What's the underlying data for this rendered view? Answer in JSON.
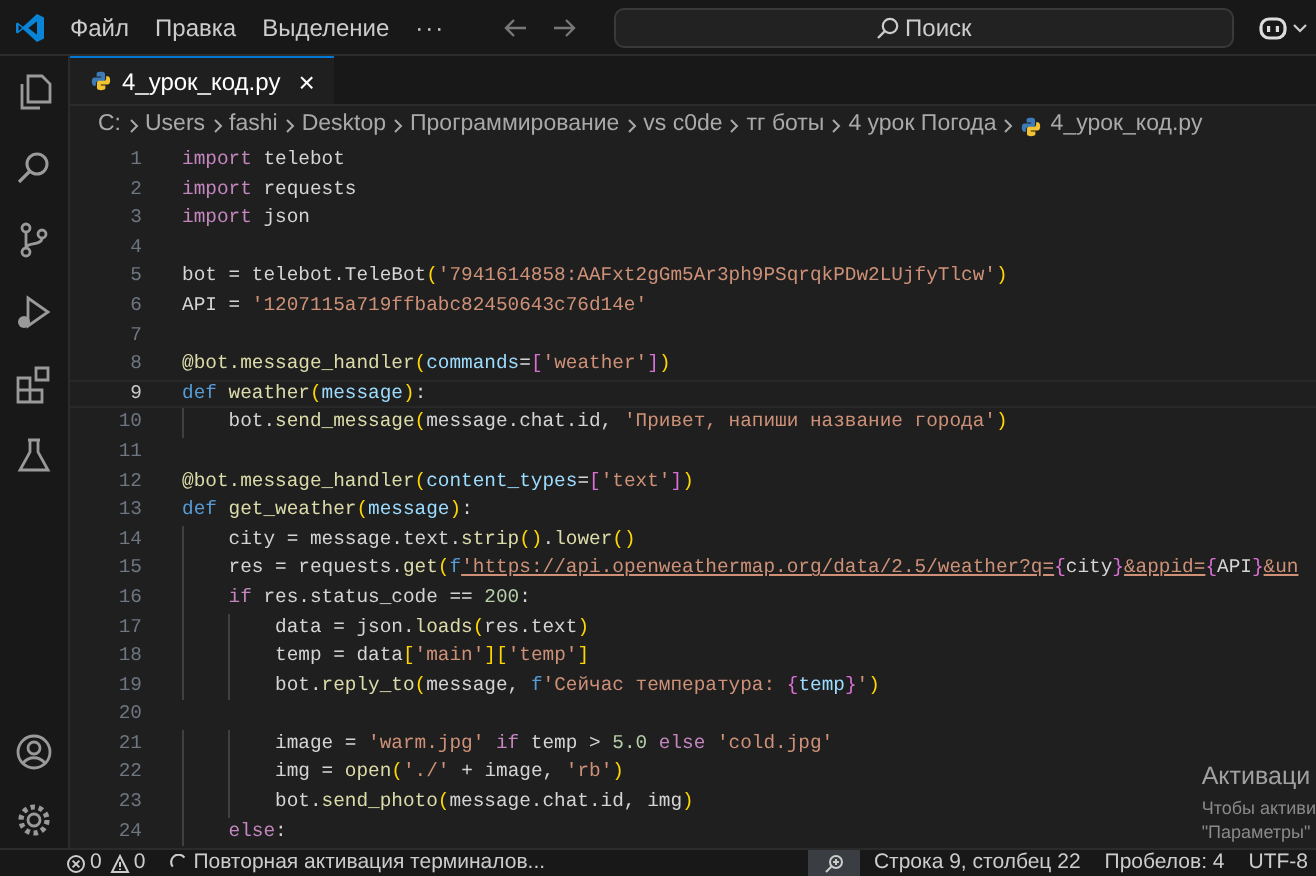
{
  "title_bar": {
    "menu": [
      "Файл",
      "Правка",
      "Выделение",
      "···"
    ],
    "search": {
      "placeholder": "Поиск"
    }
  },
  "tab": {
    "label": "4_урок_код.py",
    "selected": true,
    "close": "×"
  },
  "breadcrumbs": [
    "C:",
    "Users",
    "fashi",
    "Desktop",
    "Программирование",
    "vs c0de",
    "тг боты",
    "4 урок Погода",
    "4_урок_код.py"
  ],
  "editor": {
    "lines": [
      {
        "number": "1",
        "current": false,
        "tokens": [
          {
            "kind": "keyword",
            "text": "import"
          },
          {
            "kind": "plain",
            "text": " telebot"
          }
        ]
      },
      {
        "number": "2",
        "current": false,
        "tokens": [
          {
            "kind": "keyword",
            "text": "import"
          },
          {
            "kind": "plain",
            "text": " requests"
          }
        ]
      },
      {
        "number": "3",
        "current": false,
        "tokens": [
          {
            "kind": "keyword",
            "text": "import"
          },
          {
            "kind": "plain",
            "text": " json"
          }
        ]
      },
      {
        "number": "4",
        "current": false
      },
      {
        "number": "5",
        "current": false,
        "tokens": [
          {
            "kind": "plain",
            "text": "bot = telebot.TeleBot"
          },
          {
            "kind": "bracket1",
            "text": "("
          },
          {
            "kind": "string",
            "text": "'7941614858:AAFxt2gGm5Ar3ph9PSqrqkPDw2LUjfyTlcw'"
          },
          {
            "kind": "bracket1",
            "text": ")"
          }
        ]
      },
      {
        "number": "6",
        "current": false,
        "tokens": [
          {
            "kind": "plain",
            "text": "API = "
          },
          {
            "kind": "string",
            "text": "'1207115a719ffbabc82450643c76d14e'"
          }
        ]
      },
      {
        "number": "7",
        "current": false
      },
      {
        "number": "8",
        "current": false,
        "tokens": [
          {
            "kind": "function",
            "text": "@bot.message_handler"
          },
          {
            "kind": "bracket1",
            "text": "("
          },
          {
            "kind": "variable",
            "text": "commands"
          },
          {
            "kind": "plain",
            "text": "="
          },
          {
            "kind": "bracket2",
            "text": "["
          },
          {
            "kind": "string",
            "text": "'weather'"
          },
          {
            "kind": "bracket2",
            "text": "]"
          },
          {
            "kind": "bracket1",
            "text": ")"
          }
        ]
      },
      {
        "number": "9",
        "current": true,
        "tokens": [
          {
            "kind": "storage",
            "text": "def"
          },
          {
            "kind": "function",
            "text": " weather"
          },
          {
            "kind": "bracket1",
            "text": "("
          },
          {
            "kind": "variable",
            "text": "message"
          },
          {
            "kind": "bracket1",
            "text": ")"
          },
          {
            "kind": "plain",
            "text": ":"
          }
        ]
      },
      {
        "number": "10",
        "current": false,
        "tokens": [
          {
            "kind": "plain",
            "text": "    bot."
          },
          {
            "kind": "function",
            "text": "send_message"
          },
          {
            "kind": "bracket1",
            "text": "("
          },
          {
            "kind": "plain",
            "text": "message.chat.id, "
          },
          {
            "kind": "string",
            "text": "'Привет, напиши название города'"
          },
          {
            "kind": "bracket1",
            "text": ")"
          }
        ]
      },
      {
        "number": "11",
        "current": false
      },
      {
        "number": "12",
        "current": false,
        "tokens": [
          {
            "kind": "function",
            "text": "@bot.message_handler"
          },
          {
            "kind": "bracket1",
            "text": "("
          },
          {
            "kind": "variable",
            "text": "content_types"
          },
          {
            "kind": "plain",
            "text": "="
          },
          {
            "kind": "bracket2",
            "text": "["
          },
          {
            "kind": "string",
            "text": "'text'"
          },
          {
            "kind": "bracket2",
            "text": "]"
          },
          {
            "kind": "bracket1",
            "text": ")"
          }
        ]
      },
      {
        "number": "13",
        "current": false,
        "tokens": [
          {
            "kind": "storage",
            "text": "def"
          },
          {
            "kind": "function",
            "text": " get_weather"
          },
          {
            "kind": "bracket1",
            "text": "("
          },
          {
            "kind": "variable",
            "text": "message"
          },
          {
            "kind": "bracket1",
            "text": ")"
          },
          {
            "kind": "plain",
            "text": ":"
          }
        ]
      },
      {
        "number": "14",
        "current": false,
        "tokens": [
          {
            "kind": "plain",
            "text": "    city = message.text."
          },
          {
            "kind": "function",
            "text": "strip"
          },
          {
            "kind": "bracket1",
            "text": "()"
          },
          {
            "kind": "plain",
            "text": "."
          },
          {
            "kind": "function",
            "text": "lower"
          },
          {
            "kind": "bracket1",
            "text": "()"
          }
        ]
      },
      {
        "number": "15",
        "current": false,
        "tokens": [
          {
            "kind": "plain",
            "text": "    res = requests."
          },
          {
            "kind": "function",
            "text": "get"
          },
          {
            "kind": "bracket1",
            "text": "("
          },
          {
            "kind": "storage",
            "text": "f"
          },
          {
            "kind": "url",
            "text": "'https://api.openweathermap.org/data/2.5/weather?q="
          },
          {
            "kind": "bracket2",
            "text": "{"
          },
          {
            "kind": "plain",
            "text": "city"
          },
          {
            "kind": "bracket2",
            "text": "}"
          },
          {
            "kind": "url",
            "text": "&appid="
          },
          {
            "kind": "bracket2",
            "text": "{"
          },
          {
            "kind": "plain",
            "text": "API"
          },
          {
            "kind": "bracket2",
            "text": "}"
          },
          {
            "kind": "url",
            "text": "&un"
          }
        ]
      },
      {
        "number": "16",
        "current": false,
        "tokens": [
          {
            "kind": "keyword",
            "text": "    if"
          },
          {
            "kind": "plain",
            "text": " res.status_code == "
          },
          {
            "kind": "number",
            "text": "200"
          },
          {
            "kind": "plain",
            "text": ":"
          }
        ]
      },
      {
        "number": "17",
        "current": false,
        "tokens": [
          {
            "kind": "plain",
            "text": "        data = json."
          },
          {
            "kind": "function",
            "text": "loads"
          },
          {
            "kind": "bracket1",
            "text": "("
          },
          {
            "kind": "plain",
            "text": "res.text"
          },
          {
            "kind": "bracket1",
            "text": ")"
          }
        ]
      },
      {
        "number": "18",
        "current": false,
        "tokens": [
          {
            "kind": "plain",
            "text": "        temp = data"
          },
          {
            "kind": "bracket1",
            "text": "["
          },
          {
            "kind": "string",
            "text": "'main'"
          },
          {
            "kind": "bracket1",
            "text": "]["
          },
          {
            "kind": "string",
            "text": "'temp'"
          },
          {
            "kind": "bracket1",
            "text": "]"
          }
        ]
      },
      {
        "number": "19",
        "current": false,
        "tokens": [
          {
            "kind": "plain",
            "text": "        bot."
          },
          {
            "kind": "function",
            "text": "reply_to"
          },
          {
            "kind": "bracket1",
            "text": "("
          },
          {
            "kind": "plain",
            "text": "message, "
          },
          {
            "kind": "storage",
            "text": "f"
          },
          {
            "kind": "string",
            "text": "'Сейчас температура: "
          },
          {
            "kind": "bracket2",
            "text": "{"
          },
          {
            "kind": "variable",
            "text": "temp"
          },
          {
            "kind": "bracket2",
            "text": "}"
          },
          {
            "kind": "string",
            "text": "'"
          },
          {
            "kind": "bracket1",
            "text": ")"
          }
        ]
      },
      {
        "number": "20",
        "current": false
      },
      {
        "number": "21",
        "current": false,
        "tokens": [
          {
            "kind": "plain",
            "text": "        image = "
          },
          {
            "kind": "string",
            "text": "'warm.jpg'"
          },
          {
            "kind": "keyword",
            "text": " if"
          },
          {
            "kind": "plain",
            "text": " temp > "
          },
          {
            "kind": "number",
            "text": "5.0"
          },
          {
            "kind": "keyword",
            "text": " else"
          },
          {
            "kind": "string",
            "text": " 'cold.jpg'"
          }
        ]
      },
      {
        "number": "22",
        "current": false,
        "tokens": [
          {
            "kind": "plain",
            "text": "        img = "
          },
          {
            "kind": "function",
            "text": "open"
          },
          {
            "kind": "bracket1",
            "text": "("
          },
          {
            "kind": "string",
            "text": "'./'"
          },
          {
            "kind": "plain",
            "text": " + image, "
          },
          {
            "kind": "string",
            "text": "'rb'"
          },
          {
            "kind": "bracket1",
            "text": ")"
          }
        ]
      },
      {
        "number": "23",
        "current": false,
        "tokens": [
          {
            "kind": "plain",
            "text": "        bot."
          },
          {
            "kind": "function",
            "text": "send_photo"
          },
          {
            "kind": "bracket1",
            "text": "("
          },
          {
            "kind": "plain",
            "text": "message.chat.id, img"
          },
          {
            "kind": "bracket1",
            "text": ")"
          }
        ]
      },
      {
        "number": "24",
        "current": false,
        "tokens": [
          {
            "kind": "keyword",
            "text": "    else"
          },
          {
            "kind": "plain",
            "text": ":"
          }
        ]
      }
    ]
  },
  "activation_notice": {
    "title": "Активаци",
    "lines": [
      "Чтобы активи",
      "\"Параметры\""
    ]
  },
  "status_bar": {
    "errors": "0",
    "warnings": "0",
    "task": "Повторная активация терминалов...",
    "position": "Строка 9, столбец 22",
    "indentation": "Пробелов: 4",
    "encoding": "UTF-8"
  }
}
